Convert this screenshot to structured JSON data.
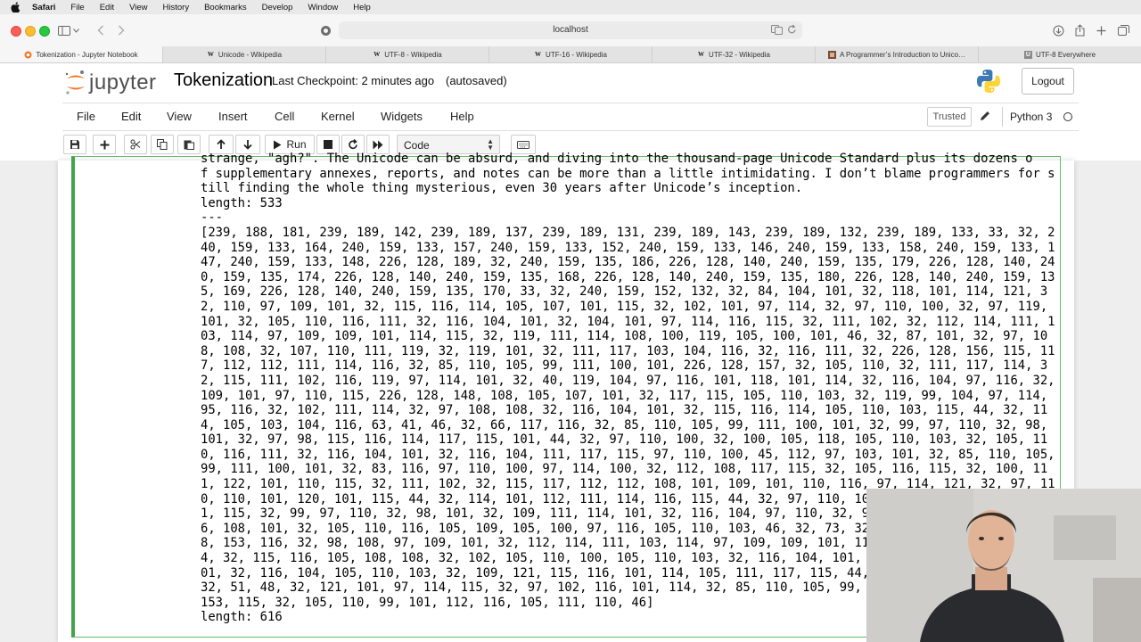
{
  "macos_menu": {
    "items": [
      "Safari",
      "File",
      "Edit",
      "View",
      "History",
      "Bookmarks",
      "Develop",
      "Window",
      "Help"
    ]
  },
  "browser": {
    "url": "localhost",
    "tabs": [
      {
        "title": "Tokenization - Jupyter Notebook",
        "favicon": "jupyter-favicon",
        "active": true
      },
      {
        "title": "Unicode - Wikipedia",
        "favicon": "W",
        "active": false
      },
      {
        "title": "UTF-8 - Wikipedia",
        "favicon": "W",
        "active": false
      },
      {
        "title": "UTF-16 - Wikipedia",
        "favicon": "W",
        "active": false
      },
      {
        "title": "UTF-32 - Wikipedia",
        "favicon": "W",
        "active": false
      },
      {
        "title": "A Programmer’s Introduction to Unico…",
        "favicon": "blog-favicon",
        "active": false
      },
      {
        "title": "UTF-8 Everywhere",
        "favicon": "U",
        "active": false
      }
    ]
  },
  "jupyter": {
    "logo_text": "jupyter",
    "notebook_title": "Tokenization",
    "checkpoint": "Last Checkpoint: 2 minutes ago",
    "autosave": "(autosaved)",
    "logout": "Logout",
    "menu": [
      "File",
      "Edit",
      "View",
      "Insert",
      "Cell",
      "Kernel",
      "Widgets",
      "Help"
    ],
    "trusted": "Trusted",
    "kernel": "Python 3",
    "run_label": "Run",
    "cell_type": "Code"
  },
  "output": {
    "lines": [
      "strange, \"agh?\". The Unicode can be absurd, and diving into the thousand-page Unicode Standard plus its dozens o",
      "f supplementary annexes, reports, and notes can be more than a little intimidating. I don’t blame programmers for s",
      "till finding the whole thing mysterious, even 30 years after Unicode’s inception.",
      "length: 533",
      "---",
      "[239, 188, 181, 239, 189, 142, 239, 189, 137, 239, 189, 131, 239, 189, 143, 239, 189, 132, 239, 189, 133, 33, 32, 2",
      "40, 159, 133, 164, 240, 159, 133, 157, 240, 159, 133, 152, 240, 159, 133, 146, 240, 159, 133, 158, 240, 159, 133, 1",
      "47, 240, 159, 133, 148, 226, 128, 189, 32, 240, 159, 135, 186, 226, 128, 140, 240, 159, 135, 179, 226, 128, 140, 24",
      "0, 159, 135, 174, 226, 128, 140, 240, 159, 135, 168, 226, 128, 140, 240, 159, 135, 180, 226, 128, 140, 240, 159, 13",
      "5, 169, 226, 128, 140, 240, 159, 135, 170, 33, 32, 240, 159, 152, 132, 32, 84, 104, 101, 32, 118, 101, 114, 121, 3",
      "2, 110, 97, 109, 101, 32, 115, 116, 114, 105, 107, 101, 115, 32, 102, 101, 97, 114, 32, 97, 110, 100, 32, 97, 119,",
      "101, 32, 105, 110, 116, 111, 32, 116, 104, 101, 32, 104, 101, 97, 114, 116, 115, 32, 111, 102, 32, 112, 114, 111, 1",
      "03, 114, 97, 109, 109, 101, 114, 115, 32, 119, 111, 114, 108, 100, 119, 105, 100, 101, 46, 32, 87, 101, 32, 97, 10",
      "8, 108, 32, 107, 110, 111, 119, 32, 119, 101, 32, 111, 117, 103, 104, 116, 32, 116, 111, 32, 226, 128, 156, 115, 11",
      "7, 112, 112, 111, 114, 116, 32, 85, 110, 105, 99, 111, 100, 101, 226, 128, 157, 32, 105, 110, 32, 111, 117, 114, 3",
      "2, 115, 111, 102, 116, 119, 97, 114, 101, 32, 40, 119, 104, 97, 116, 101, 118, 101, 114, 32, 116, 104, 97, 116, 32,",
      "109, 101, 97, 110, 115, 226, 128, 148, 108, 105, 107, 101, 32, 117, 115, 105, 110, 103, 32, 119, 99, 104, 97, 114,",
      "95, 116, 32, 102, 111, 114, 32, 97, 108, 108, 32, 116, 104, 101, 32, 115, 116, 114, 105, 110, 103, 115, 44, 32, 11",
      "4, 105, 103, 104, 116, 63, 41, 46, 32, 66, 117, 116, 32, 85, 110, 105, 99, 111, 100, 101, 32, 99, 97, 110, 32, 98,",
      "101, 32, 97, 98, 115, 116, 114, 117, 115, 101, 44, 32, 97, 110, 100, 32, 100, 105, 118, 105, 110, 103, 32, 105, 11",
      "0, 116, 111, 32, 116, 104, 101, 32, 116, 104, 111, 117, 115, 97, 110, 100, 45, 112, 97, 103, 101, 32, 85, 110, 105,",
      "99, 111, 100, 101, 32, 83, 116, 97, 110, 100, 97, 114, 100, 32, 112, 108, 117, 115, 32, 105, 116, 115, 32, 100, 11",
      "1, 122, 101, 110, 115, 32, 111, 102, 32, 115, 117, 112, 112, 108, 101, 109, 101, 110, 116, 97, 114, 121, 32, 97, 11",
      "0, 110, 101, 120, 101, 115, 44, 32, 114, 101, 112, 111, 114, 116, 115, 44, 32, 97, 110, 100, 32, 110, 111, 116, 10",
      "1, 115, 32, 99, 97, 110, 32, 98, 101, 32, 109, 111, 114, 101, 32, 116, 104, 97, 110, 32, 97, 32, 108, 105, 116, 11",
      "6, 108, 101, 32, 105, 110, 116, 105, 109, 105, 100, 97, 116, 105, 110, 103, 46, 32, 73, 32, 100, 111, 110, 226, 12",
      "8, 153, 116, 32, 98, 108, 97, 109, 101, 32, 112, 114, 111, 103, 114, 97, 109, 109, 101, 114, 115, 32, 102, 111, 11",
      "4, 32, 115, 116, 105, 108, 108, 32, 102, 105, 110, 100, 105, 110, 103, 32, 116, 104, 101, 32, 119, 104, 111, 108, 1",
      "01, 32, 116, 104, 105, 110, 103, 32, 109, 121, 115, 116, 101, 114, 105, 111, 117, 115, 44, 32, 101, 118, 101, 110,",
      "32, 51, 48, 32, 121, 101, 97, 114, 115, 32, 97, 102, 116, 101, 114, 32, 85, 110, 105, 99, 111, 100, 101, 226, 128,",
      "153, 115, 32, 105, 110, 99, 101, 112, 116, 105, 111, 110, 46]",
      "length: 616"
    ]
  },
  "colors": {
    "cell_border": "#42a54b",
    "jupyter_orange": "#f37726"
  }
}
